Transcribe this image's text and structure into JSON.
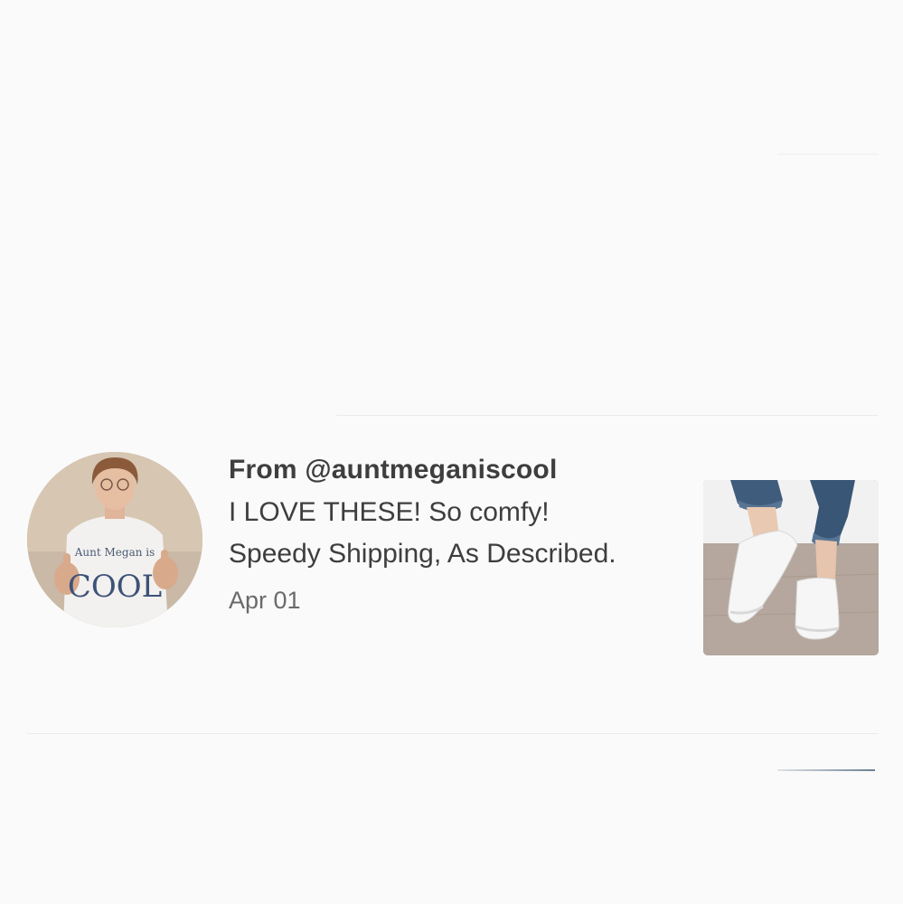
{
  "review": {
    "from": "From @auntmeganiscool",
    "text": "I LOVE THESE! So comfy! Speedy Shipping, As Described.",
    "date": "Apr 01",
    "avatar_shirt_text_top": "Aunt Megan is",
    "avatar_shirt_text_main": "COOL"
  },
  "colors": {
    "background": "#fafafa",
    "text_primary": "#3e3e3e",
    "text_secondary": "#6a6a6a",
    "divider": "#ebebeb"
  }
}
